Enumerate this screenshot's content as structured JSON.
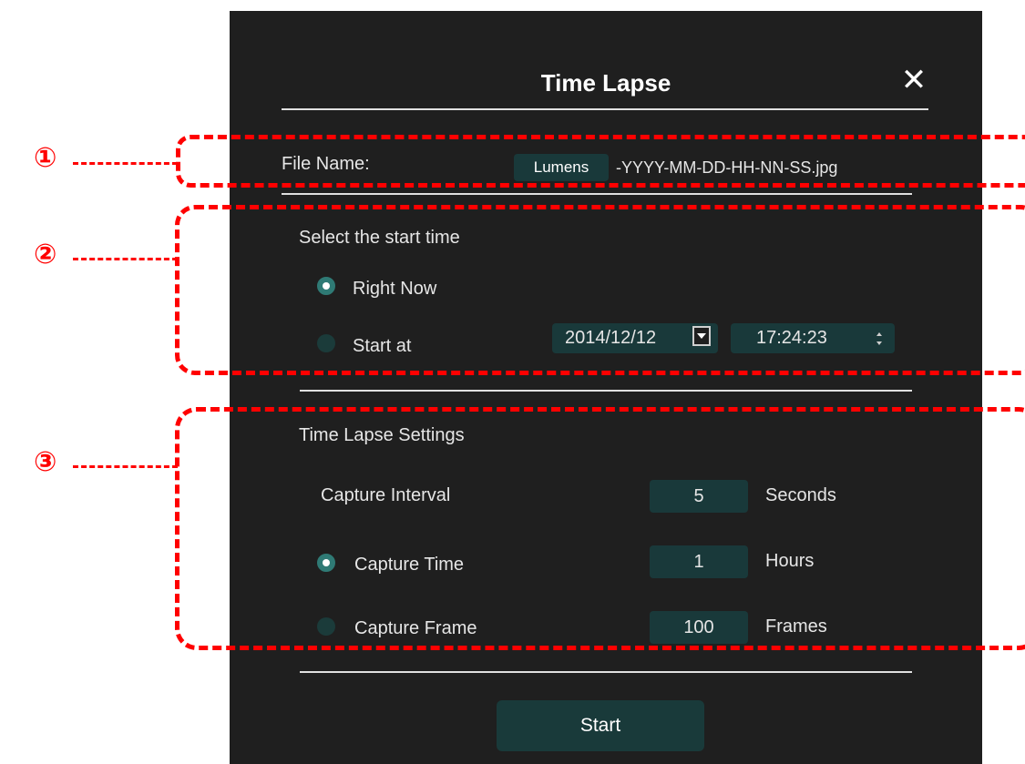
{
  "dialog": {
    "title": "Time Lapse",
    "close_glyph": "✕"
  },
  "file_name": {
    "label": "File Name:",
    "prefix_value": "Lumens",
    "suffix_text": "-YYYY-MM-DD-HH-NN-SS.jpg"
  },
  "start_time": {
    "section_label": "Select the start time",
    "options": [
      {
        "label": "Right Now",
        "selected": true
      },
      {
        "label": "Start at",
        "selected": false
      }
    ],
    "date_value": "2014/12/12",
    "time_value": "17:24:23"
  },
  "settings": {
    "section_label": "Time Lapse Settings",
    "capture_interval": {
      "label": "Capture Interval",
      "value": "5",
      "unit": "Seconds"
    },
    "capture_time": {
      "label": "Capture Time",
      "value": "1",
      "unit": "Hours",
      "selected": true
    },
    "capture_frame": {
      "label": "Capture Frame",
      "value": "100",
      "unit": "Frames",
      "selected": false
    }
  },
  "start_button": {
    "label": "Start"
  },
  "annotations": {
    "markers": [
      "①",
      "②",
      "③"
    ],
    "color": "#ff0000"
  },
  "colors": {
    "dialog_bg": "#1f1f1f",
    "field_bg": "#19393a",
    "accent": "#2f7a75"
  },
  "icons": {
    "close": "close-icon",
    "date_dropdown": "chevron-down-icon",
    "time_spinner": "spinner-arrows-icon"
  }
}
